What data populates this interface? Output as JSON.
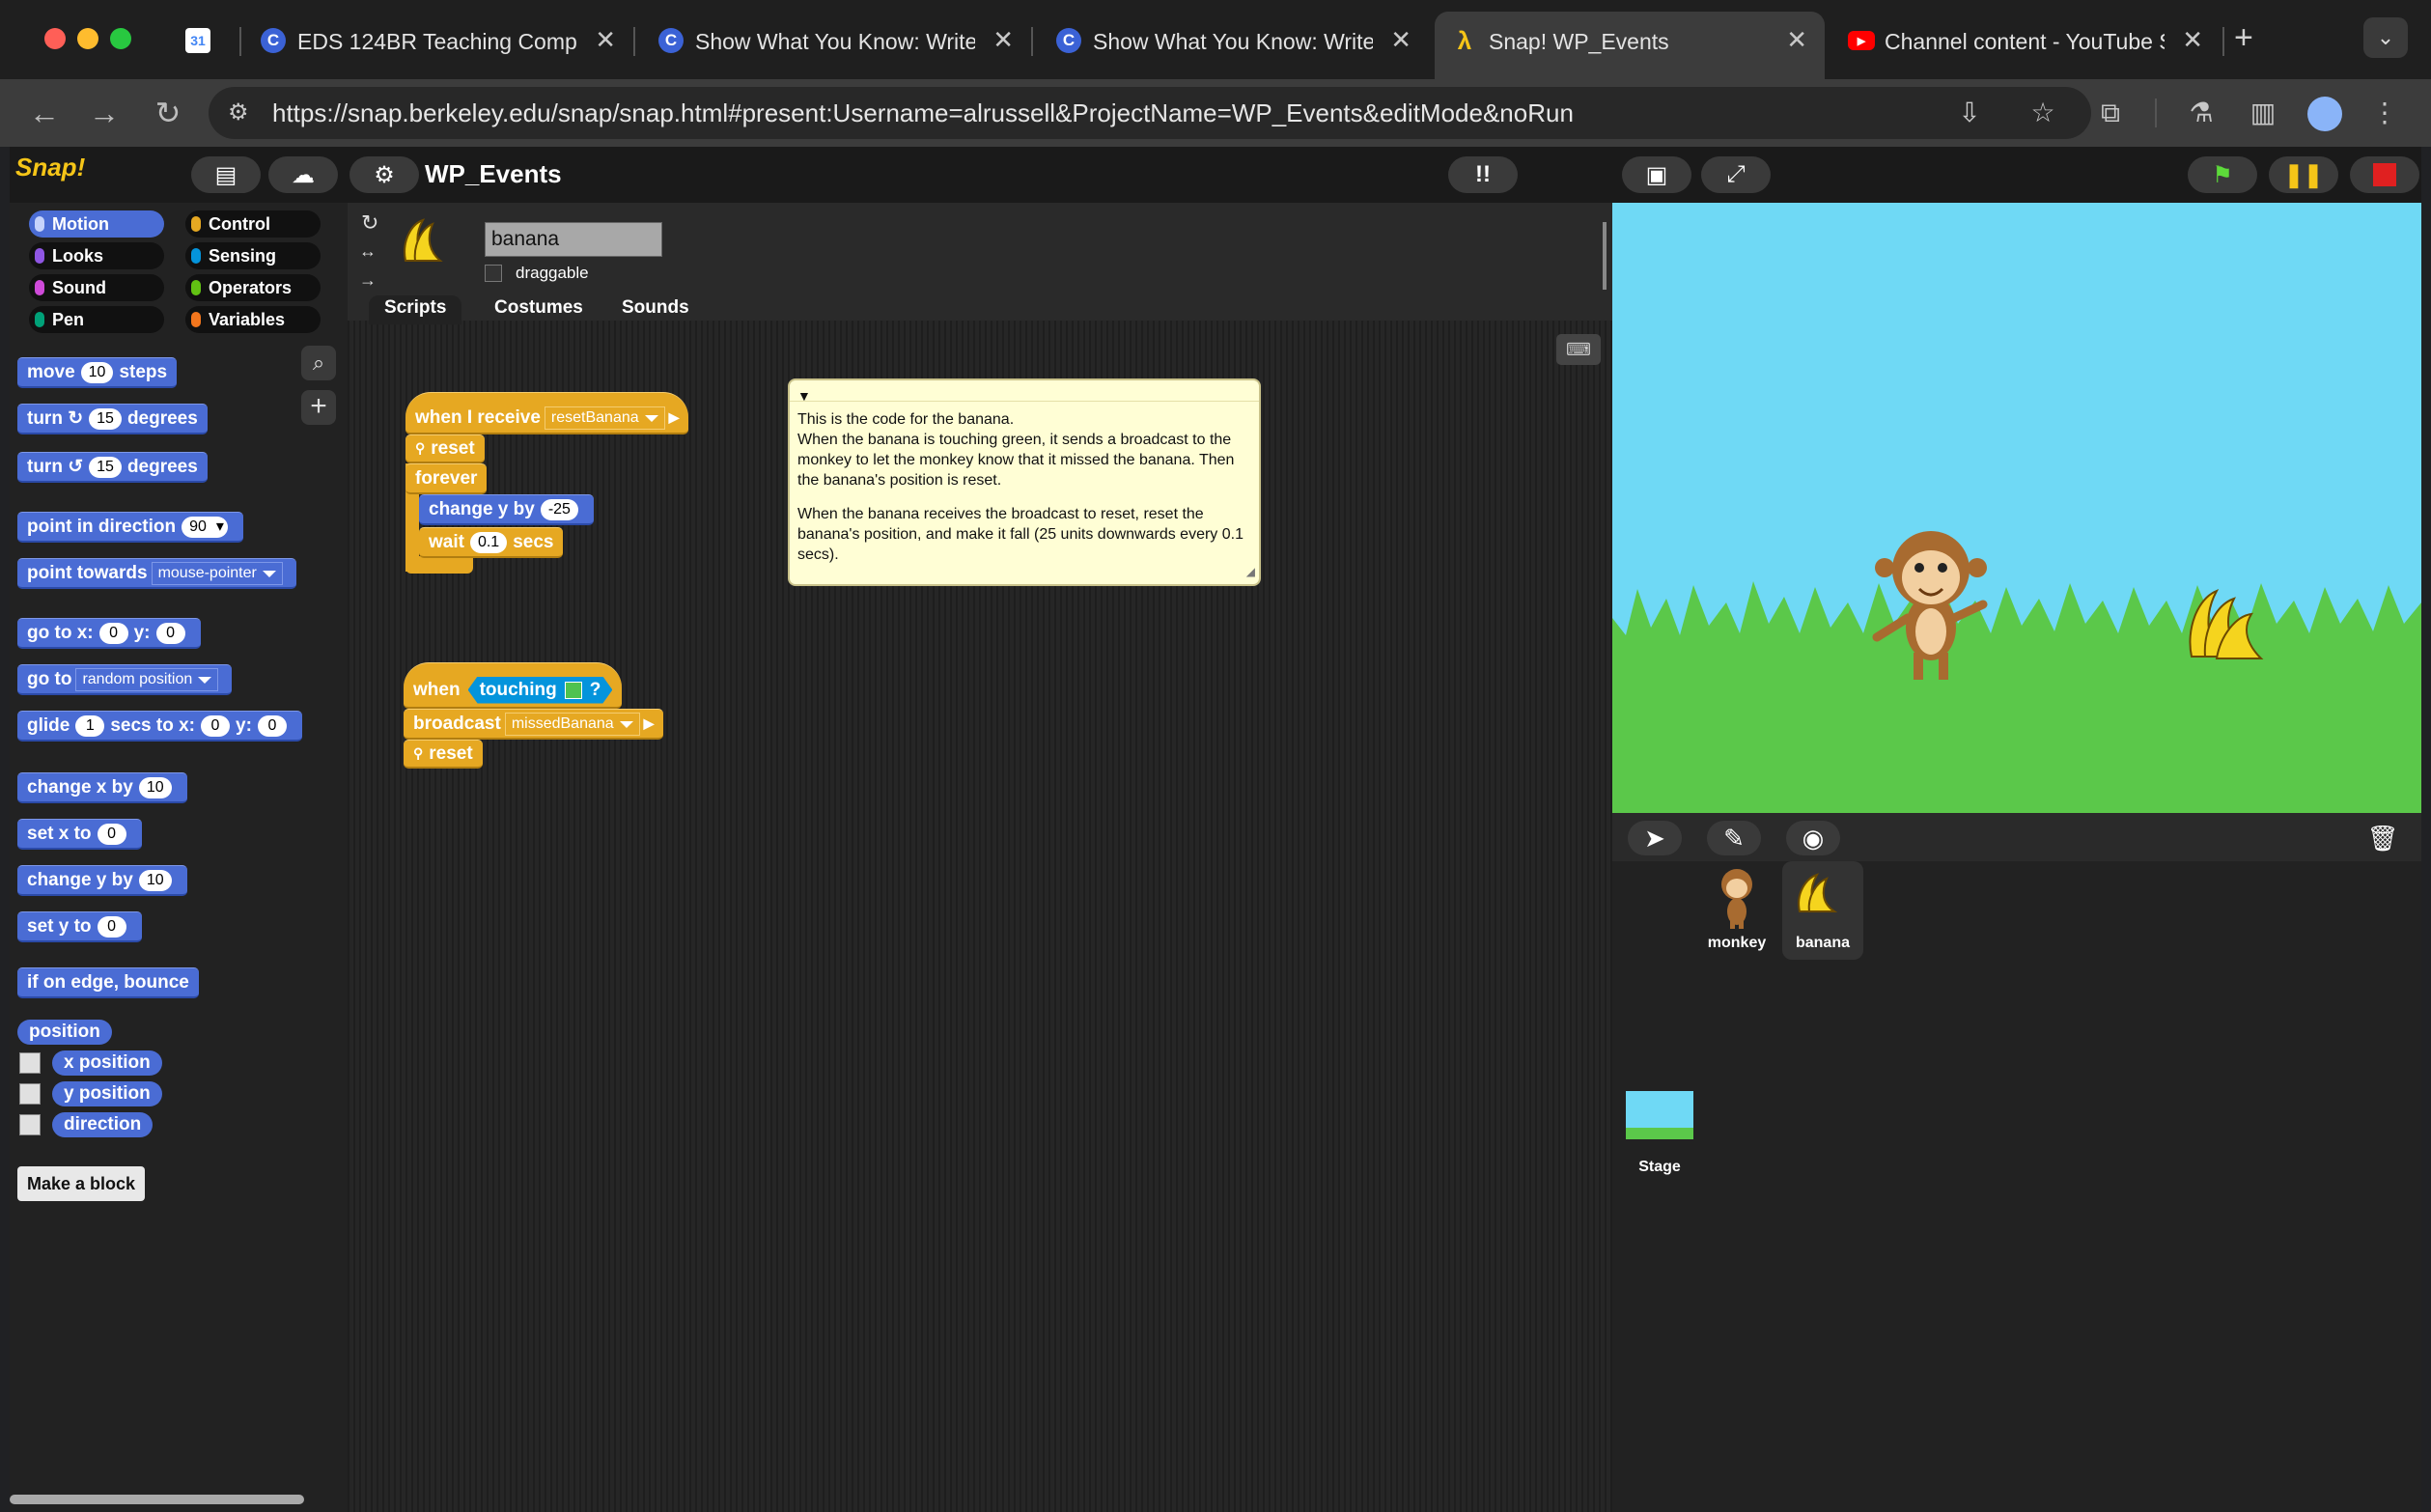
{
  "browser": {
    "tabs": [
      {
        "title": "",
        "icon": "calendar-icon"
      },
      {
        "title": "EDS 124BR Teaching Compu",
        "icon": "c-icon"
      },
      {
        "title": "Show What You Know: Write",
        "icon": "c-icon"
      },
      {
        "title": "Show What You Know: Write",
        "icon": "c-icon"
      },
      {
        "title": "Snap! WP_Events",
        "icon": "lambda-icon"
      },
      {
        "title": "Channel content - YouTube S",
        "icon": "youtube-icon"
      }
    ],
    "active_tab": 4,
    "url": "https://snap.berkeley.edu/snap/snap.html#present:Username=alrussell&ProjectName=WP_Events&editMode&noRun"
  },
  "snap": {
    "logo": "Snap!",
    "project_name": "WP_Events",
    "categories": [
      {
        "label": "Motion",
        "color": "#4a6cd4"
      },
      {
        "label": "Control",
        "color": "#e6a822"
      },
      {
        "label": "Looks",
        "color": "#8f56e3"
      },
      {
        "label": "Sensing",
        "color": "#0494dc"
      },
      {
        "label": "Sound",
        "color": "#cf4ad9"
      },
      {
        "label": "Operators",
        "color": "#62c213"
      },
      {
        "label": "Pen",
        "color": "#00a178"
      },
      {
        "label": "Variables",
        "color": "#f3761d"
      }
    ],
    "palette": {
      "move": "move",
      "move_val": "10",
      "steps": "steps",
      "turn": "turn",
      "turn_cw_val": "15",
      "degrees": "degrees",
      "turn_ccw_val": "15",
      "point_dir": "point in direction",
      "point_dir_val": "90",
      "point_towards": "point towards",
      "point_towards_val": "mouse-pointer",
      "goto_xy": "go to x:",
      "goto_x": "0",
      "y": "y:",
      "goto_y": "0",
      "goto": "go to",
      "goto_val": "random position",
      "glide": "glide",
      "glide_val": "1",
      "secs_to_x": "secs to x:",
      "glide_x": "0",
      "glide_y": "0",
      "change_x": "change x by",
      "change_x_val": "10",
      "set_x": "set x to",
      "set_x_val": "0",
      "change_y": "change y by",
      "change_y_val": "10",
      "set_y": "set y to",
      "set_y_val": "0",
      "bounce": "if on edge, bounce",
      "position": "position",
      "x_position": "x position",
      "y_position": "y position",
      "direction": "direction",
      "make_block": "Make a block"
    },
    "sprite": {
      "name": "banana",
      "draggable": "draggable"
    },
    "editor_tabs": [
      "Scripts",
      "Costumes",
      "Sounds"
    ],
    "script1": {
      "hat": "when I receive",
      "hat_val": "resetBanana",
      "reset": "reset",
      "forever": "forever",
      "change_y": "change y by",
      "change_y_val": "-25",
      "wait": "wait",
      "wait_val": "0.1",
      "secs": "secs"
    },
    "script2": {
      "when": "when",
      "touching": "touching",
      "q": "?",
      "broadcast": "broadcast",
      "broadcast_val": "missedBanana",
      "reset": "reset"
    },
    "note": {
      "line1": "This is the code for the banana.",
      "line2": "When the banana is touching green, it sends a broadcast to the monkey to let the monkey know that it missed the banana. Then the banana's position is reset.",
      "line3": "When the banana receives the broadcast to reset, reset the banana's position, and make it fall (25 units downwards every 0.1 secs)."
    },
    "corral": {
      "sprites": [
        {
          "name": "monkey"
        },
        {
          "name": "banana"
        }
      ],
      "stage_label": "Stage"
    }
  }
}
